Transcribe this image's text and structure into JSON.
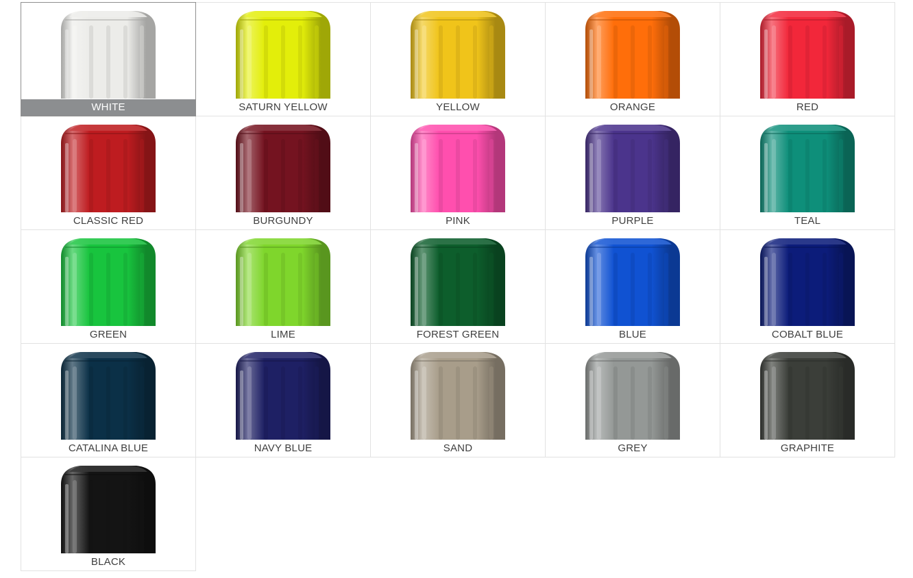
{
  "selected_index": 0,
  "swatches": [
    {
      "label": "WHITE",
      "color": "#ecece9"
    },
    {
      "label": "SATURN YELLOW",
      "color": "#e3ee0a"
    },
    {
      "label": "YELLOW",
      "color": "#f0c41a"
    },
    {
      "label": "ORANGE",
      "color": "#ff6e0a"
    },
    {
      "label": "RED",
      "color": "#f2273a"
    },
    {
      "label": "CLASSIC RED",
      "color": "#be1c20"
    },
    {
      "label": "BURGUNDY",
      "color": "#741320"
    },
    {
      "label": "PINK",
      "color": "#ff4fae"
    },
    {
      "label": "PURPLE",
      "color": "#4b348c"
    },
    {
      "label": "TEAL",
      "color": "#0e8f7a"
    },
    {
      "label": "GREEN",
      "color": "#18c43e"
    },
    {
      "label": "LIME",
      "color": "#7fd62c"
    },
    {
      "label": "FOREST GREEN",
      "color": "#0d5e2c"
    },
    {
      "label": "BLUE",
      "color": "#1052d2"
    },
    {
      "label": "COBALT BLUE",
      "color": "#0c1c7a"
    },
    {
      "label": "CATALINA BLUE",
      "color": "#0b3047"
    },
    {
      "label": "NAVY BLUE",
      "color": "#1e2064"
    },
    {
      "label": "SAND",
      "color": "#a89d8a"
    },
    {
      "label": "GREY",
      "color": "#949896"
    },
    {
      "label": "GRAPHITE",
      "color": "#3b3e39"
    },
    {
      "label": "BLACK",
      "color": "#141414"
    }
  ]
}
